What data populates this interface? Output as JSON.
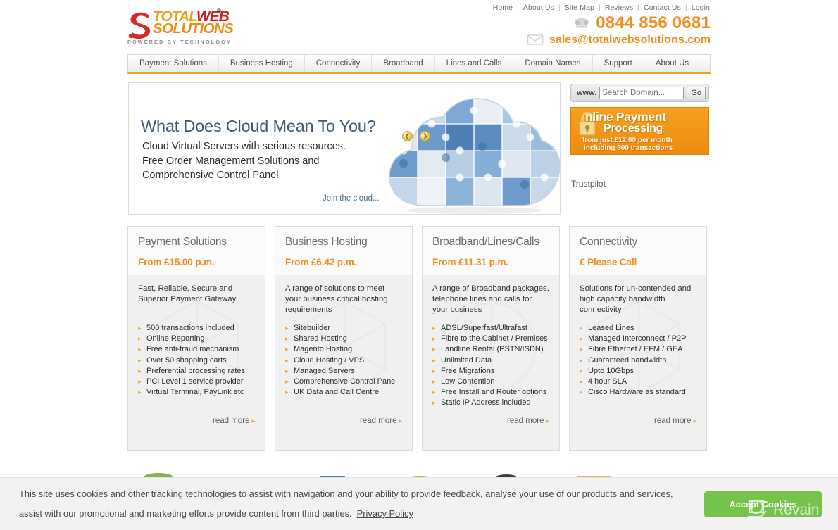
{
  "top_nav": {
    "links": [
      "Home",
      "About Us",
      "Site Map",
      "Reviews",
      "Contact Us",
      "Login"
    ],
    "separator": "|"
  },
  "logo": {
    "word_total": "TOTAL",
    "word_web": "WEB",
    "word_solutions": "SOLUTIONS",
    "registered": "®",
    "tagline": "POWERED BY TECHNOLOGY"
  },
  "contact": {
    "phone_icon": "telephone-icon",
    "phone": "0844 856 0681",
    "email_icon": "envelope-icon",
    "email": "sales@totalwebsolutions.com",
    "accent_color": "#ef8f22"
  },
  "main_nav": {
    "items": [
      "Payment Solutions",
      "Business Hosting",
      "Connectivity",
      "Broadband",
      "Lines and Calls",
      "Domain Names",
      "Support",
      "About Us"
    ],
    "underline_color": "#e8a61c"
  },
  "hero": {
    "title": "What Does Cloud Mean To You?",
    "subtitle": "Cloud Virtual Servers with serious resources.\nFree Order Management Solutions and\nComprehensive Control Panel",
    "cta": "Join the cloud...",
    "image_name": "cloud-jigsaw-puzzle-image",
    "prev_arrow": "❮",
    "next_arrow": "❯"
  },
  "domain_search": {
    "prefix": "www.",
    "placeholder": "Search Domain...",
    "value": "",
    "button": "Go"
  },
  "promo": {
    "line1": "nline Payment",
    "line2": "Processing",
    "line3": "from just £12.00 per month",
    "line4": "including 500 transactions",
    "icon": "padlock-icon",
    "bg_color": "#f5a11e"
  },
  "trustpilot": {
    "label": "Trustpilot"
  },
  "cards": [
    {
      "title": "Payment Solutions",
      "price": "From £15.00 p.m.",
      "description": "Fast, Reliable, Secure and Superior Payment Gateway.",
      "features": [
        "500 transactions included",
        "Online Reporting",
        "Free anti-fraud mechanism",
        "Over 50 shopping carts",
        "Preferential processing rates",
        "PCI Level 1 service provider",
        "Virtual Terminal, PayLink etc"
      ],
      "read_more": "read more"
    },
    {
      "title": "Business Hosting",
      "price": "From £6.42 p.m.",
      "description": "A range of solutions to meet your business critical hosting requirements",
      "features": [
        "Sitebuilder",
        "Shared Hosting",
        "Magento Hosting",
        "Cloud Hosting / VPS",
        "Managed Servers",
        "Comprehensive Control Panel",
        "UK Data and Call Centre"
      ],
      "read_more": "read more"
    },
    {
      "title": "Broadband/Lines/Calls",
      "price": "From £11.31 p.m.",
      "description": "A range of Broadband packages, telephone lines and calls for your business",
      "features": [
        "ADSL/Superfast/Ultrafast",
        "Fibre to the Cabinet / Premises",
        "Landline Rental (PSTN/ISDN)",
        "Unlimited Data",
        "Free Migrations",
        "Low Contention",
        "Free Install and Router options",
        "Static IP Address included"
      ],
      "read_more": "read more"
    },
    {
      "title": "Connectivity",
      "price": "£ Please Call",
      "description": "Solutions for un-contended and high capacity bandwidth connectivity",
      "features": [
        "Leased Lines",
        "Managed Interconnect / P2P",
        "Fibre Ethernet / EFM / GEA",
        "Guaranteed bandwidth",
        "Upto 10Gbps",
        "4 hour SLA",
        "Cisco Hardware as standard"
      ],
      "read_more": "read more"
    }
  ],
  "cookie_bar": {
    "text": "This site uses cookies and other tracking technologies to assist with navigation and your ability to provide feedback, analyse your use of our products and services, assist with our promotional and marketing efforts provide content from third parties.",
    "privacy_link": "Privacy Policy",
    "accept_button": "Accept Cookies",
    "button_color": "#76c34b"
  },
  "watermark": {
    "text": "Revain"
  }
}
